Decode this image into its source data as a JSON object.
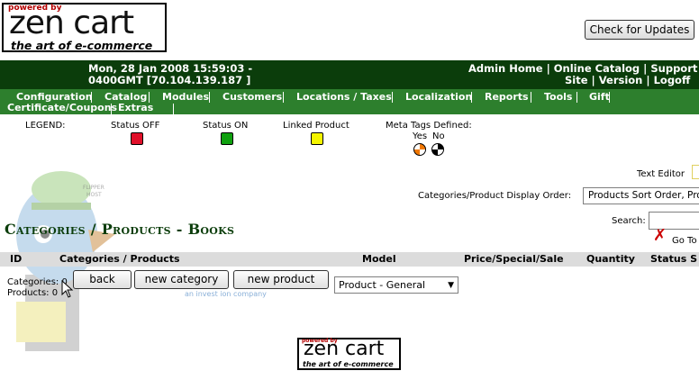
{
  "logo": {
    "powered": "powered by",
    "brand": "zen cart",
    "tagline": "the art of e-commerce"
  },
  "check_updates_label": "Check for Updates",
  "header": {
    "datetime_line1": "Mon, 28 Jan 2008 15:59:03 -",
    "datetime_line2": "0400GMT [70.104.139.187 ]",
    "links_line1": [
      "Admin Home",
      "Online Catalog",
      "Support"
    ],
    "links_line2": [
      "Site",
      "Version",
      "Logoff"
    ]
  },
  "nav": {
    "items": [
      "Configuration",
      "Catalog",
      "Modules",
      "Customers",
      "Locations / Taxes",
      "Localization",
      "Reports",
      "Tools",
      "Gift"
    ],
    "items_row2": [
      "Certificate/Coupons",
      "Extras"
    ]
  },
  "legend": {
    "label": "LEGEND:",
    "status_off": "Status OFF",
    "status_on": "Status ON",
    "linked": "Linked Product",
    "meta": "Meta Tags Defined:",
    "yes": "Yes",
    "no": "No",
    "colors": {
      "off": "#e0102a",
      "on": "#0fa00f",
      "linked": "#f5f500"
    }
  },
  "text_editor_label": "Text Editor",
  "display_order": {
    "label": "Categories/Product Display Order:",
    "value": "Products Sort Order, Produ"
  },
  "page_title": "Categories / Products - Books",
  "search": {
    "label": "Search:",
    "goto": "Go To"
  },
  "columns": [
    "ID",
    "Categories / Products",
    "Model",
    "Price/Special/Sale",
    "Quantity",
    "Status S"
  ],
  "counts": {
    "categories": "Categories: 0",
    "products": "Products: 0"
  },
  "buttons": {
    "back": "back",
    "new_category": "new category",
    "new_product": "new product"
  },
  "product_type": "Product - General",
  "watermark": {
    "flipper": "FLIPPER",
    "host": "HOST",
    "company": "an invest ion company"
  }
}
